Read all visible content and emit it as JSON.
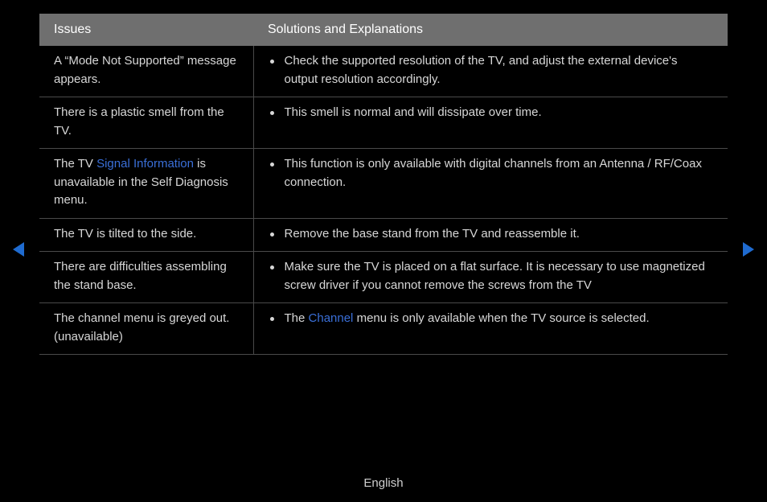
{
  "header": {
    "issues": "Issues",
    "solutions": "Solutions and Explanations"
  },
  "rows": [
    {
      "issue": [
        {
          "t": "A “Mode Not Supported” message appears."
        }
      ],
      "sol": [
        [
          {
            "t": "Check the supported resolution of the TV, and adjust the external device's output resolution accordingly."
          }
        ]
      ]
    },
    {
      "issue": [
        {
          "t": "There is a plastic smell from the TV."
        }
      ],
      "sol": [
        [
          {
            "t": "This smell is normal and will dissipate over time."
          }
        ]
      ]
    },
    {
      "issue": [
        {
          "t": "The TV "
        },
        {
          "t": "Signal Information",
          "hl": true
        },
        {
          "t": " is unavailable in the Self Diagnosis menu."
        }
      ],
      "sol": [
        [
          {
            "t": "This function is only available with digital channels from an Antenna / RF/Coax connection."
          }
        ]
      ]
    },
    {
      "issue": [
        {
          "t": "The TV is tilted to the side."
        }
      ],
      "sol": [
        [
          {
            "t": "Remove the base stand from the TV and reassemble it."
          }
        ]
      ]
    },
    {
      "issue": [
        {
          "t": "There are difficulties assembling the stand base."
        }
      ],
      "sol": [
        [
          {
            "t": "Make sure the TV is placed on a flat surface. It is necessary to use magnetized screw driver if you cannot remove the screws from the TV"
          }
        ]
      ]
    },
    {
      "issue": [
        {
          "t": "The channel menu is greyed out. (unavailable)"
        }
      ],
      "sol": [
        [
          {
            "t": "The "
          },
          {
            "t": "Channel",
            "hl": true
          },
          {
            "t": " menu is only available when the TV source is selected."
          }
        ]
      ]
    }
  ],
  "footer": {
    "language": "English"
  },
  "icons": {
    "prev_color": "#1f6bd0",
    "next_color": "#1f6bd0"
  }
}
